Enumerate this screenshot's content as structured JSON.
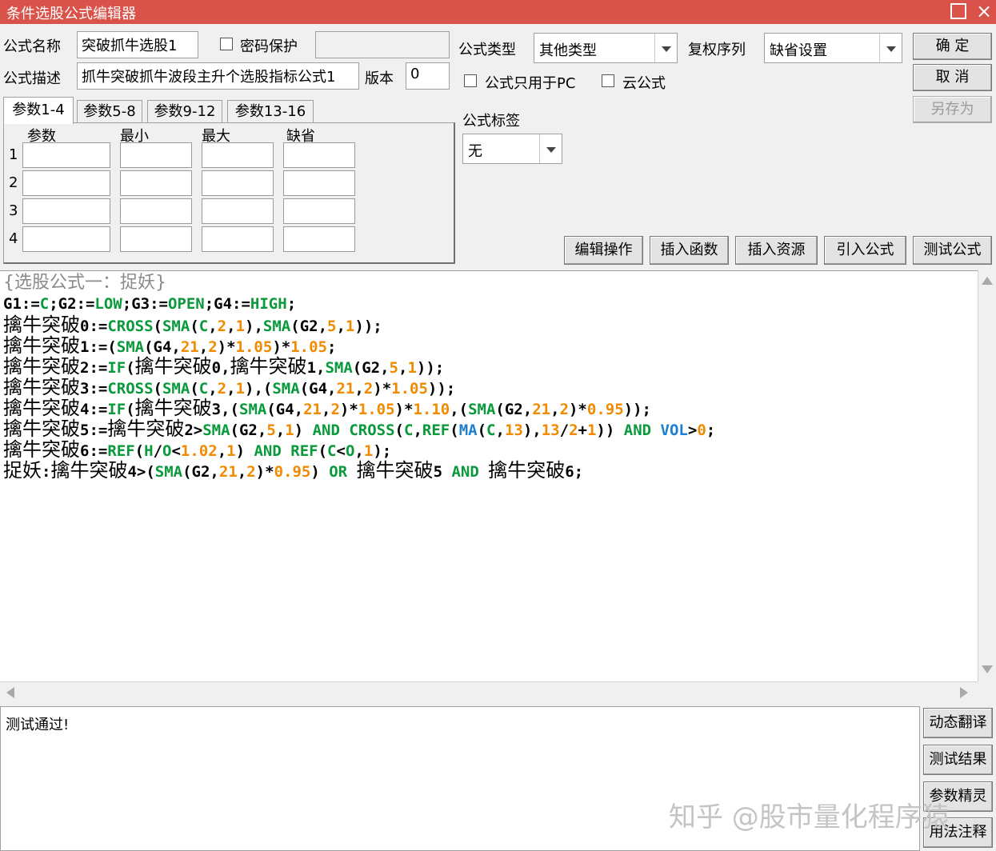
{
  "window": {
    "title": "条件选股公式编辑器",
    "maximize_icon": "maximize-icon",
    "close_icon": "close-icon",
    "close_glyph": "×"
  },
  "form": {
    "name_label": "公式名称",
    "name_value": "突破抓牛选股1",
    "password_label": "密码保护",
    "password_checked": false,
    "desc_label": "公式描述",
    "desc_value": "抓牛突破抓牛波段主升个选股指标公式1",
    "version_label": "版本",
    "version_value": "0",
    "type_label": "公式类型",
    "type_value": "其他类型",
    "adjust_label": "复权序列",
    "adjust_value": "缺省设置",
    "pc_only_label": "公式只用于PC",
    "cloud_label": "云公式",
    "tag_label": "公式标签",
    "tag_value": "无"
  },
  "buttons": {
    "ok": "确  定",
    "cancel": "取  消",
    "save_as": "另存为"
  },
  "tabs": [
    "参数1-4",
    "参数5-8",
    "参数9-12",
    "参数13-16"
  ],
  "params": {
    "headers": [
      "参数",
      "最小",
      "最大",
      "缺省"
    ],
    "rows": [
      "1",
      "2",
      "3",
      "4"
    ]
  },
  "toolbar": [
    "编辑操作",
    "插入函数",
    "插入资源",
    "引入公式",
    "测试公式"
  ],
  "code": [
    [
      {
        "t": "{选股公式一：捉妖}",
        "c": "gray"
      }
    ],
    [
      {
        "t": "G1:=",
        "c": "black"
      },
      {
        "t": "C",
        "c": "green"
      },
      {
        "t": ";G2:=",
        "c": "black"
      },
      {
        "t": "LOW",
        "c": "green"
      },
      {
        "t": ";G3:=",
        "c": "black"
      },
      {
        "t": "OPEN",
        "c": "green"
      },
      {
        "t": ";G4:=",
        "c": "black"
      },
      {
        "t": "HIGH",
        "c": "green"
      },
      {
        "t": ";",
        "c": "black"
      }
    ],
    [
      {
        "t": "擒牛突破",
        "c": "cn"
      },
      {
        "t": "0:=",
        "c": "black"
      },
      {
        "t": "CROSS",
        "c": "green"
      },
      {
        "t": "(",
        "c": "black"
      },
      {
        "t": "SMA",
        "c": "green"
      },
      {
        "t": "(",
        "c": "black"
      },
      {
        "t": "C",
        "c": "green"
      },
      {
        "t": ",",
        "c": "black"
      },
      {
        "t": "2",
        "c": "orange"
      },
      {
        "t": ",",
        "c": "black"
      },
      {
        "t": "1",
        "c": "orange"
      },
      {
        "t": "),",
        "c": "black"
      },
      {
        "t": "SMA",
        "c": "green"
      },
      {
        "t": "(G2,",
        "c": "black"
      },
      {
        "t": "5",
        "c": "orange"
      },
      {
        "t": ",",
        "c": "black"
      },
      {
        "t": "1",
        "c": "orange"
      },
      {
        "t": "));",
        "c": "black"
      }
    ],
    [
      {
        "t": "擒牛突破",
        "c": "cn"
      },
      {
        "t": "1:=(",
        "c": "black"
      },
      {
        "t": "SMA",
        "c": "green"
      },
      {
        "t": "(G4,",
        "c": "black"
      },
      {
        "t": "21",
        "c": "orange"
      },
      {
        "t": ",",
        "c": "black"
      },
      {
        "t": "2",
        "c": "orange"
      },
      {
        "t": ")*",
        "c": "black"
      },
      {
        "t": "1.05",
        "c": "orange"
      },
      {
        "t": ")*",
        "c": "black"
      },
      {
        "t": "1.05",
        "c": "orange"
      },
      {
        "t": ";",
        "c": "black"
      }
    ],
    [
      {
        "t": "擒牛突破",
        "c": "cn"
      },
      {
        "t": "2:=",
        "c": "black"
      },
      {
        "t": "IF",
        "c": "green"
      },
      {
        "t": "(",
        "c": "black"
      },
      {
        "t": "擒牛突破",
        "c": "cn"
      },
      {
        "t": "0,",
        "c": "black"
      },
      {
        "t": "擒牛突破",
        "c": "cn"
      },
      {
        "t": "1,",
        "c": "black"
      },
      {
        "t": "SMA",
        "c": "green"
      },
      {
        "t": "(G2,",
        "c": "black"
      },
      {
        "t": "5",
        "c": "orange"
      },
      {
        "t": ",",
        "c": "black"
      },
      {
        "t": "1",
        "c": "orange"
      },
      {
        "t": "));",
        "c": "black"
      }
    ],
    [
      {
        "t": "擒牛突破",
        "c": "cn"
      },
      {
        "t": "3:=",
        "c": "black"
      },
      {
        "t": "CROSS",
        "c": "green"
      },
      {
        "t": "(",
        "c": "black"
      },
      {
        "t": "SMA",
        "c": "green"
      },
      {
        "t": "(",
        "c": "black"
      },
      {
        "t": "C",
        "c": "green"
      },
      {
        "t": ",",
        "c": "black"
      },
      {
        "t": "2",
        "c": "orange"
      },
      {
        "t": ",",
        "c": "black"
      },
      {
        "t": "1",
        "c": "orange"
      },
      {
        "t": "),(",
        "c": "black"
      },
      {
        "t": "SMA",
        "c": "green"
      },
      {
        "t": "(G4,",
        "c": "black"
      },
      {
        "t": "21",
        "c": "orange"
      },
      {
        "t": ",",
        "c": "black"
      },
      {
        "t": "2",
        "c": "orange"
      },
      {
        "t": ")*",
        "c": "black"
      },
      {
        "t": "1.05",
        "c": "orange"
      },
      {
        "t": "));",
        "c": "black"
      }
    ],
    [
      {
        "t": "擒牛突破",
        "c": "cn"
      },
      {
        "t": "4:=",
        "c": "black"
      },
      {
        "t": "IF",
        "c": "green"
      },
      {
        "t": "(",
        "c": "black"
      },
      {
        "t": "擒牛突破",
        "c": "cn"
      },
      {
        "t": "3,(",
        "c": "black"
      },
      {
        "t": "SMA",
        "c": "green"
      },
      {
        "t": "(G4,",
        "c": "black"
      },
      {
        "t": "21",
        "c": "orange"
      },
      {
        "t": ",",
        "c": "black"
      },
      {
        "t": "2",
        "c": "orange"
      },
      {
        "t": ")*",
        "c": "black"
      },
      {
        "t": "1.05",
        "c": "orange"
      },
      {
        "t": ")*",
        "c": "black"
      },
      {
        "t": "1.10",
        "c": "orange"
      },
      {
        "t": ",(",
        "c": "black"
      },
      {
        "t": "SMA",
        "c": "green"
      },
      {
        "t": "(G2,",
        "c": "black"
      },
      {
        "t": "21",
        "c": "orange"
      },
      {
        "t": ",",
        "c": "black"
      },
      {
        "t": "2",
        "c": "orange"
      },
      {
        "t": ")*",
        "c": "black"
      },
      {
        "t": "0.95",
        "c": "orange"
      },
      {
        "t": "));",
        "c": "black"
      }
    ],
    [
      {
        "t": "擒牛突破",
        "c": "cn"
      },
      {
        "t": "5:=",
        "c": "black"
      },
      {
        "t": "擒牛突破",
        "c": "cn"
      },
      {
        "t": "2>",
        "c": "black"
      },
      {
        "t": "SMA",
        "c": "green"
      },
      {
        "t": "(G2,",
        "c": "black"
      },
      {
        "t": "5",
        "c": "orange"
      },
      {
        "t": ",",
        "c": "black"
      },
      {
        "t": "1",
        "c": "orange"
      },
      {
        "t": ") ",
        "c": "black"
      },
      {
        "t": "AND",
        "c": "green"
      },
      {
        "t": " ",
        "c": "black"
      },
      {
        "t": "CROSS",
        "c": "green"
      },
      {
        "t": "(",
        "c": "black"
      },
      {
        "t": "C",
        "c": "green"
      },
      {
        "t": ",",
        "c": "black"
      },
      {
        "t": "REF",
        "c": "green"
      },
      {
        "t": "(",
        "c": "black"
      },
      {
        "t": "MA",
        "c": "blue"
      },
      {
        "t": "(",
        "c": "black"
      },
      {
        "t": "C",
        "c": "green"
      },
      {
        "t": ",",
        "c": "black"
      },
      {
        "t": "13",
        "c": "orange"
      },
      {
        "t": "),",
        "c": "black"
      },
      {
        "t": "13",
        "c": "orange"
      },
      {
        "t": "/",
        "c": "black"
      },
      {
        "t": "2",
        "c": "orange"
      },
      {
        "t": "+",
        "c": "black"
      },
      {
        "t": "1",
        "c": "orange"
      },
      {
        "t": ")) ",
        "c": "black"
      },
      {
        "t": "AND",
        "c": "green"
      },
      {
        "t": " ",
        "c": "black"
      },
      {
        "t": "VOL",
        "c": "blue"
      },
      {
        "t": ">",
        "c": "black"
      },
      {
        "t": "0",
        "c": "orange"
      },
      {
        "t": ";",
        "c": "black"
      }
    ],
    [
      {
        "t": "擒牛突破",
        "c": "cn"
      },
      {
        "t": "6:=",
        "c": "black"
      },
      {
        "t": "REF",
        "c": "green"
      },
      {
        "t": "(",
        "c": "black"
      },
      {
        "t": "H",
        "c": "green"
      },
      {
        "t": "/",
        "c": "black"
      },
      {
        "t": "O",
        "c": "green"
      },
      {
        "t": "<",
        "c": "black"
      },
      {
        "t": "1.02",
        "c": "orange"
      },
      {
        "t": ",",
        "c": "black"
      },
      {
        "t": "1",
        "c": "orange"
      },
      {
        "t": ") ",
        "c": "black"
      },
      {
        "t": "AND",
        "c": "green"
      },
      {
        "t": " ",
        "c": "black"
      },
      {
        "t": "REF",
        "c": "green"
      },
      {
        "t": "(",
        "c": "black"
      },
      {
        "t": "C",
        "c": "green"
      },
      {
        "t": "<",
        "c": "black"
      },
      {
        "t": "O",
        "c": "green"
      },
      {
        "t": ",",
        "c": "black"
      },
      {
        "t": "1",
        "c": "orange"
      },
      {
        "t": ");",
        "c": "black"
      }
    ],
    [
      {
        "t": "捉妖",
        "c": "cn"
      },
      {
        "t": ":",
        "c": "black"
      },
      {
        "t": "擒牛突破",
        "c": "cn"
      },
      {
        "t": "4>(",
        "c": "black"
      },
      {
        "t": "SMA",
        "c": "green"
      },
      {
        "t": "(G2,",
        "c": "black"
      },
      {
        "t": "21",
        "c": "orange"
      },
      {
        "t": ",",
        "c": "black"
      },
      {
        "t": "2",
        "c": "orange"
      },
      {
        "t": ")*",
        "c": "black"
      },
      {
        "t": "0.95",
        "c": "orange"
      },
      {
        "t": ") ",
        "c": "black"
      },
      {
        "t": "OR",
        "c": "green"
      },
      {
        "t": " ",
        "c": "black"
      },
      {
        "t": "擒牛突破",
        "c": "cn"
      },
      {
        "t": "5 ",
        "c": "black"
      },
      {
        "t": "AND",
        "c": "green"
      },
      {
        "t": " ",
        "c": "black"
      },
      {
        "t": "擒牛突破",
        "c": "cn"
      },
      {
        "t": "6;",
        "c": "black"
      }
    ]
  ],
  "result_text": "测试通过!",
  "side_buttons": [
    "动态翻译",
    "测试结果",
    "参数精灵",
    "用法注释"
  ],
  "watermark": "知乎 @股市量化程序猿",
  "colors": {
    "titlebar": "#d9534a",
    "keyword": "#0a9a3c",
    "number": "#f08a00",
    "builtin": "#1d7fd0",
    "comment": "#8a8a8a"
  }
}
